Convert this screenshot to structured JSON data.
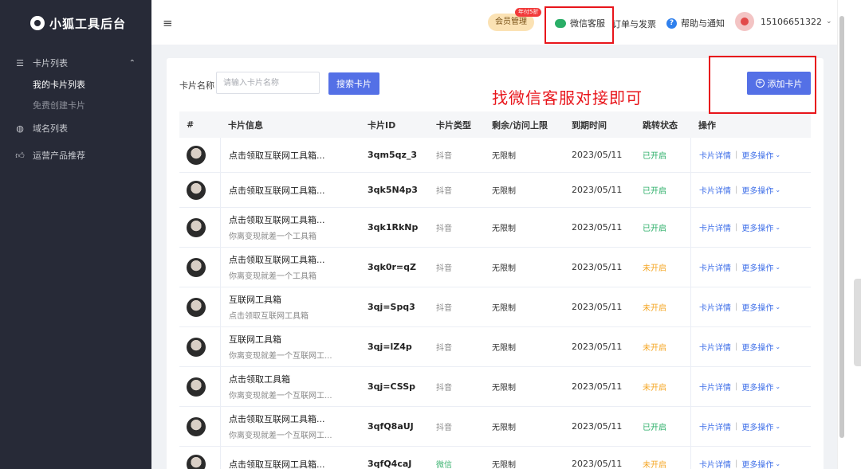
{
  "app": {
    "name": "小狐工具后台"
  },
  "sidebar": {
    "items": [
      {
        "label": "卡片列表",
        "icon": "list-icon",
        "expanded": true,
        "children": [
          {
            "label": "我的卡片列表",
            "active": true
          },
          {
            "label": "免费创建卡片",
            "active": false
          }
        ]
      },
      {
        "label": "域名列表",
        "icon": "globe-icon"
      },
      {
        "label": "运营产品推荐",
        "icon": "thumbs-up-icon"
      }
    ]
  },
  "topbar": {
    "vip_label": "会员管理",
    "vip_badge": "年付5折",
    "wechat_label": "微信客服",
    "orders_label": "订单与发票",
    "help_label": "帮助与通知",
    "user_phone": "15106651322",
    "caret": "⌄"
  },
  "search": {
    "label": "卡片名称",
    "placeholder": "请输入卡片名称",
    "button": "搜索卡片"
  },
  "add_button": "添加卡片",
  "annotation": "找微信客服对接即可",
  "colors": {
    "primary": "#5470e6",
    "sidebar_bg": "#272a37",
    "status_on": "#2aae67",
    "status_off": "#f5a623",
    "highlight_red": "#e8151b"
  },
  "table": {
    "headers": [
      "#",
      "卡片信息",
      "卡片ID",
      "卡片类型",
      "剩余/访问上限",
      "到期时间",
      "跳转状态",
      "操作"
    ],
    "detail_label": "卡片详情",
    "more_label": "更多操作",
    "rows": [
      {
        "title": "点击领取互联网工具箱...",
        "subtitle": "",
        "id": "3qm5qz_3",
        "type": "抖音",
        "limit": "无限制",
        "expire": "2023/05/11",
        "status": "已开启"
      },
      {
        "title": "点击领取互联网工具箱...",
        "subtitle": "",
        "id": "3qk5N4p3",
        "type": "抖音",
        "limit": "无限制",
        "expire": "2023/05/11",
        "status": "已开启"
      },
      {
        "title": "点击领取互联网工具箱...",
        "subtitle": "你离变现就差一个工具箱",
        "id": "3qk1RkNp",
        "type": "抖音",
        "limit": "无限制",
        "expire": "2023/05/11",
        "status": "已开启"
      },
      {
        "title": "点击领取互联网工具箱...",
        "subtitle": "你离变现就差一个工具箱",
        "id": "3qk0r=qZ",
        "type": "抖音",
        "limit": "无限制",
        "expire": "2023/05/11",
        "status": "未开启"
      },
      {
        "title": "互联网工具箱",
        "subtitle": "点击领取互联网工具箱",
        "id": "3qj=Spq3",
        "type": "抖音",
        "limit": "无限制",
        "expire": "2023/05/11",
        "status": "未开启"
      },
      {
        "title": "互联网工具箱",
        "subtitle": "你离变现就差一个互联网工...",
        "id": "3qj=lZ4p",
        "type": "抖音",
        "limit": "无限制",
        "expire": "2023/05/11",
        "status": "未开启"
      },
      {
        "title": "点击领取工具箱",
        "subtitle": "你离变现就差一个互联网工...",
        "id": "3qj=CSSp",
        "type": "抖音",
        "limit": "无限制",
        "expire": "2023/05/11",
        "status": "未开启"
      },
      {
        "title": "点击领取互联网工具箱...",
        "subtitle": "你离变现就差一个互联网工...",
        "id": "3qfQ8aUJ",
        "type": "抖音",
        "limit": "无限制",
        "expire": "2023/05/11",
        "status": "已开启"
      },
      {
        "title": "点击领取互联网工具箱...",
        "subtitle": "",
        "id": "3qfQ4caJ",
        "type": "微信",
        "limit": "无限制",
        "expire": "2023/05/11",
        "status": "未开启"
      }
    ]
  }
}
